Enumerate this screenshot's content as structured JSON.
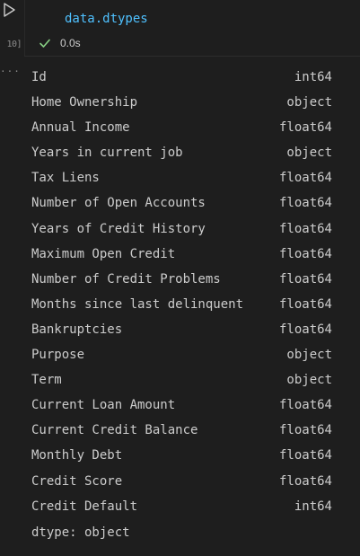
{
  "cell": {
    "exec_count": "10]",
    "code": "data.dtypes",
    "exec_time": "0.0s",
    "more_indicator": "..."
  },
  "output": {
    "rows": [
      {
        "name": "Id",
        "dtype": "int64"
      },
      {
        "name": "Home Ownership",
        "dtype": "object"
      },
      {
        "name": "Annual Income",
        "dtype": "float64"
      },
      {
        "name": "Years in current job",
        "dtype": "object"
      },
      {
        "name": "Tax Liens",
        "dtype": "float64"
      },
      {
        "name": "Number of Open Accounts",
        "dtype": "float64"
      },
      {
        "name": "Years of Credit History",
        "dtype": "float64"
      },
      {
        "name": "Maximum Open Credit",
        "dtype": "float64"
      },
      {
        "name": "Number of Credit Problems",
        "dtype": "float64"
      },
      {
        "name": "Months since last delinquent",
        "dtype": "float64"
      },
      {
        "name": "Bankruptcies",
        "dtype": "float64"
      },
      {
        "name": "Purpose",
        "dtype": "object"
      },
      {
        "name": "Term",
        "dtype": "object"
      },
      {
        "name": "Current Loan Amount",
        "dtype": "float64"
      },
      {
        "name": "Current Credit Balance",
        "dtype": "float64"
      },
      {
        "name": "Monthly Debt",
        "dtype": "float64"
      },
      {
        "name": "Credit Score",
        "dtype": "float64"
      },
      {
        "name": "Credit Default",
        "dtype": "int64"
      }
    ],
    "footer": "dtype: object"
  },
  "icons": {
    "run": "play-icon",
    "status": "check-icon"
  },
  "colors": {
    "background": "#1e1e1e",
    "code_text": "#4fc1ff",
    "success": "#89d185",
    "text": "#cccccc"
  }
}
